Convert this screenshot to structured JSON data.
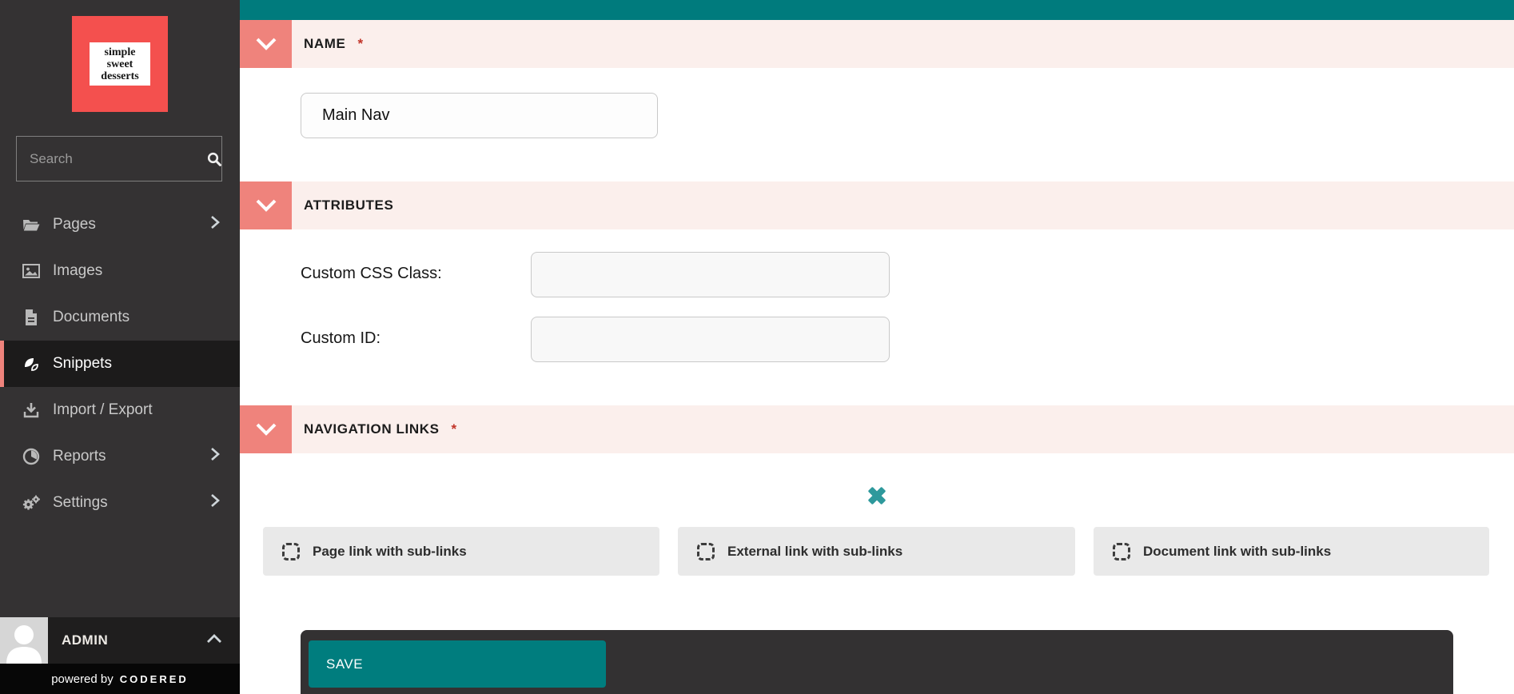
{
  "colors": {
    "teal": "#007B7D",
    "coral": "#EF837C",
    "logo_red": "#F4504E",
    "pink_band": "#FBEFEC",
    "sidebar_bg": "#343233"
  },
  "sidebar": {
    "logo": {
      "line1": "simple",
      "line2": "sweet",
      "line3": "desserts"
    },
    "search": {
      "placeholder": "Search"
    },
    "items": [
      {
        "label": "Pages"
      },
      {
        "label": "Images"
      },
      {
        "label": "Documents"
      },
      {
        "label": "Snippets"
      },
      {
        "label": "Import / Export"
      },
      {
        "label": "Reports"
      },
      {
        "label": "Settings"
      }
    ],
    "user": {
      "name": "ADMIN"
    },
    "powered_by": {
      "prefix": "powered by",
      "brand": "CodeRed"
    }
  },
  "main": {
    "required_marker": "*",
    "name_section": {
      "title": "NAME",
      "value": "Main Nav"
    },
    "attributes_section": {
      "title": "ATTRIBUTES",
      "fields": [
        {
          "label": "Custom CSS Class:",
          "value": ""
        },
        {
          "label": "Custom ID:",
          "value": ""
        }
      ]
    },
    "nav_links_section": {
      "title": "NAVIGATION LINKS",
      "add_buttons": [
        {
          "label": "Page link with sub-links"
        },
        {
          "label": "External link with sub-links"
        },
        {
          "label": "Document link with sub-links"
        }
      ]
    },
    "footer": {
      "save_label": "SAVE"
    }
  }
}
